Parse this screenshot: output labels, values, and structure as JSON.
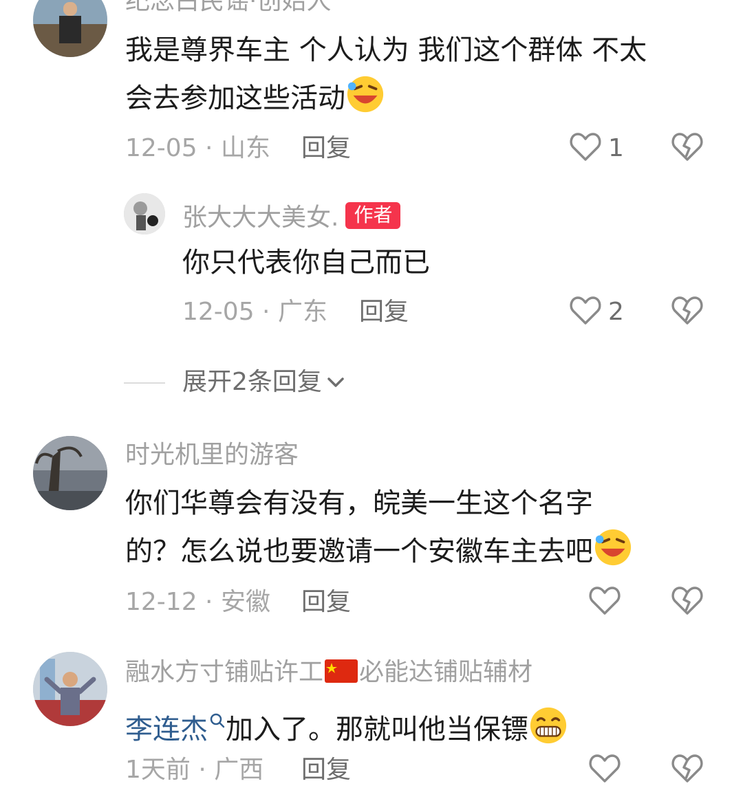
{
  "comments": [
    {
      "username": "纪念白民谣·创始人",
      "content_line1": "我是尊界车主 个人认为 我们这个群体 不太",
      "content_line2": "会去参加这些活动",
      "date": "12-05",
      "location": "山东",
      "reply_label": "回复",
      "likes": "1"
    },
    {
      "username": "张大大大美女.",
      "badge": "作者",
      "content": "你只代表你自己而已",
      "date": "12-05",
      "location": "广东",
      "reply_label": "回复",
      "likes": "2"
    },
    {
      "expand_label": "展开2条回复"
    },
    {
      "username": "时光机里的游客",
      "content_line1": "你们华尊会有没有，皖美一生这个名字",
      "content_line2": "的？怎么说也要邀请一个安徽车主去吧",
      "date": "12-12",
      "location": "安徽",
      "reply_label": "回复"
    },
    {
      "username_part1": "融水方寸铺贴许工",
      "username_part2": "必能达铺贴辅材",
      "content_link": "李连杰",
      "content_rest": "加入了。那就叫他当保镖",
      "date": "1天前",
      "location": "广西",
      "reply_label": "回复"
    }
  ],
  "separator": " · ",
  "icons": {
    "like": "heart-outline-icon",
    "dislike": "broken-heart-icon",
    "expand": "chevron-down-icon",
    "emoji_laugh": "rofl-emoji-icon",
    "emoji_grin": "grin-emoji-icon",
    "search": "search-icon",
    "flag": "china-flag-icon"
  },
  "colors": {
    "badge": "#f5344c",
    "link": "#2f5d8f",
    "meta": "#a6a6a6"
  }
}
